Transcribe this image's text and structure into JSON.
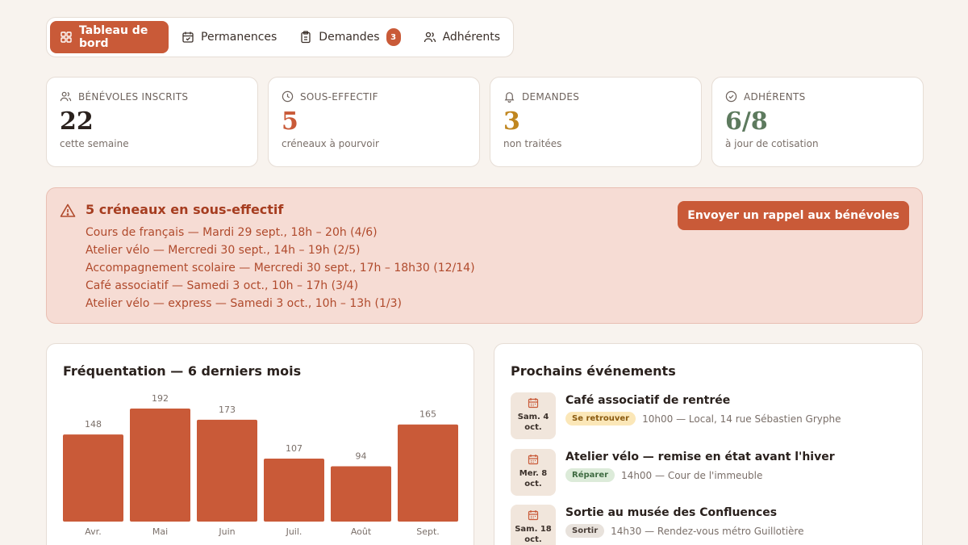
{
  "tabs": [
    {
      "label": "Tableau de bord",
      "active": true
    },
    {
      "label": "Permanences"
    },
    {
      "label": "Demandes",
      "badge": "3"
    },
    {
      "label": "Adhérents"
    }
  ],
  "stats": [
    {
      "label": "BÉNÉVOLES INSCRITS",
      "value": "22",
      "sub": "cette semaine",
      "color": "#2a211d",
      "icon": "users-icon"
    },
    {
      "label": "SOUS-EFFECTIF",
      "value": "5",
      "sub": "créneaux à pourvoir",
      "color": "#c95a38",
      "icon": "clock-icon"
    },
    {
      "label": "DEMANDES",
      "value": "3",
      "sub": "non traitées",
      "color": "#c0861f",
      "icon": "bell-icon"
    },
    {
      "label": "ADHÉRENTS",
      "value": "6/8",
      "sub": "à jour de cotisation",
      "color": "#5d7a5e",
      "icon": "check-circle-icon"
    }
  ],
  "alert": {
    "title": "5 créneaux en sous-effectif",
    "items": [
      "Cours de français — Mardi 29 sept., 18h – 20h (4/6)",
      "Atelier vélo — Mercredi 30 sept., 14h – 19h (2/5)",
      "Accompagnement scolaire — Mercredi 30 sept., 17h – 18h30 (12/14)",
      "Café associatif — Samedi 3 oct., 10h – 17h (3/4)",
      "Atelier vélo — express — Samedi 3 oct., 10h – 13h (1/3)"
    ],
    "button": "Envoyer un rappel aux bénévoles"
  },
  "chart_panel": {
    "title": "Fréquentation — 6 derniers mois"
  },
  "chart_data": {
    "type": "bar",
    "categories": [
      "Avr.",
      "Mai",
      "Juin",
      "Juil.",
      "Août",
      "Sept."
    ],
    "values": [
      148,
      192,
      173,
      107,
      94,
      165
    ],
    "title": "Fréquentation — 6 derniers mois",
    "color": "#c95a38"
  },
  "events_panel": {
    "title": "Prochains événements"
  },
  "events": [
    {
      "date1": "Sam. 4",
      "date2": "oct.",
      "name": "Café associatif de rentrée",
      "tag": "Se retrouver",
      "tag_bg": "#fbe7b8",
      "tag_fg": "#8a5a10",
      "meta": "10h00 — Local, 14 rue Sébastien Gryphe"
    },
    {
      "date1": "Mer. 8",
      "date2": "oct.",
      "name": "Atelier vélo — remise en état avant l'hiver",
      "tag": "Réparer",
      "tag_bg": "#dcebd9",
      "tag_fg": "#3f6b42",
      "meta": "14h00 — Cour de l'immeuble"
    },
    {
      "date1": "Sam. 18",
      "date2": "oct.",
      "name": "Sortie au musée des Confluences",
      "tag": "Sortir",
      "tag_bg": "#e8e2dc",
      "tag_fg": "#4a3f39",
      "meta": "14h30 — Rendez-vous métro Guillotière"
    }
  ]
}
